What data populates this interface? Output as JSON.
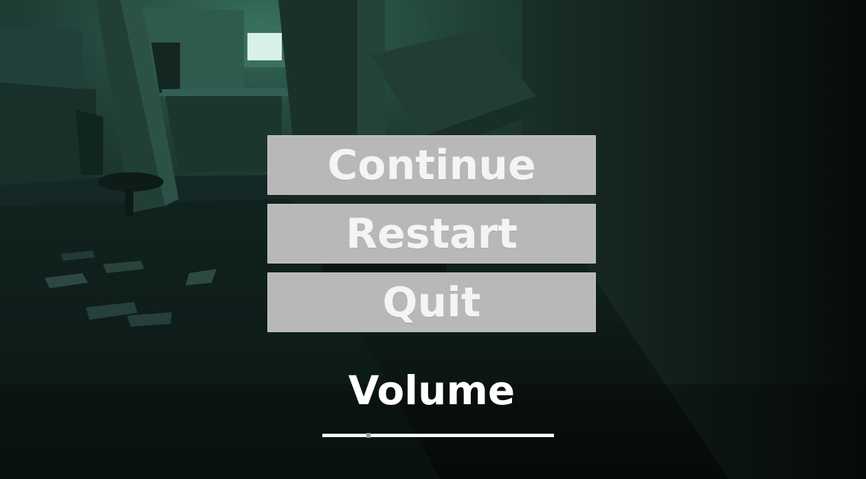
{
  "menu": {
    "continue_label": "Continue",
    "restart_label": "Restart",
    "quit_label": "Quit"
  },
  "volume": {
    "label": "Volume",
    "level": 0.2
  },
  "colors": {
    "button_bg": "#b8b8b8",
    "button_text": "#f4f4f4",
    "label_text": "#ffffff",
    "scene_tint": "#0c1513"
  }
}
